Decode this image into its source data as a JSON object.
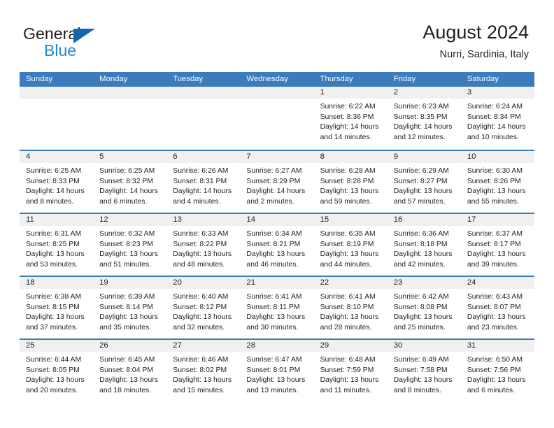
{
  "brand": {
    "name_top": "General",
    "name_bottom": "Blue"
  },
  "header": {
    "title": "August 2024",
    "location": "Nurri, Sardinia, Italy"
  },
  "colors": {
    "header_blue": "#3b7cbe",
    "logo_blue": "#2389cf",
    "triangle_blue": "#1566b0",
    "day_band": "#f0f0f0",
    "text": "#231f20"
  },
  "weekdays": [
    "Sunday",
    "Monday",
    "Tuesday",
    "Wednesday",
    "Thursday",
    "Friday",
    "Saturday"
  ],
  "weeks": [
    [
      {
        "day": "",
        "lines": []
      },
      {
        "day": "",
        "lines": []
      },
      {
        "day": "",
        "lines": []
      },
      {
        "day": "",
        "lines": []
      },
      {
        "day": "1",
        "lines": [
          "Sunrise: 6:22 AM",
          "Sunset: 8:36 PM",
          "Daylight: 14 hours",
          "and 14 minutes."
        ]
      },
      {
        "day": "2",
        "lines": [
          "Sunrise: 6:23 AM",
          "Sunset: 8:35 PM",
          "Daylight: 14 hours",
          "and 12 minutes."
        ]
      },
      {
        "day": "3",
        "lines": [
          "Sunrise: 6:24 AM",
          "Sunset: 8:34 PM",
          "Daylight: 14 hours",
          "and 10 minutes."
        ]
      }
    ],
    [
      {
        "day": "4",
        "lines": [
          "Sunrise: 6:25 AM",
          "Sunset: 8:33 PM",
          "Daylight: 14 hours",
          "and 8 minutes."
        ]
      },
      {
        "day": "5",
        "lines": [
          "Sunrise: 6:25 AM",
          "Sunset: 8:32 PM",
          "Daylight: 14 hours",
          "and 6 minutes."
        ]
      },
      {
        "day": "6",
        "lines": [
          "Sunrise: 6:26 AM",
          "Sunset: 8:31 PM",
          "Daylight: 14 hours",
          "and 4 minutes."
        ]
      },
      {
        "day": "7",
        "lines": [
          "Sunrise: 6:27 AM",
          "Sunset: 8:29 PM",
          "Daylight: 14 hours",
          "and 2 minutes."
        ]
      },
      {
        "day": "8",
        "lines": [
          "Sunrise: 6:28 AM",
          "Sunset: 8:28 PM",
          "Daylight: 13 hours",
          "and 59 minutes."
        ]
      },
      {
        "day": "9",
        "lines": [
          "Sunrise: 6:29 AM",
          "Sunset: 8:27 PM",
          "Daylight: 13 hours",
          "and 57 minutes."
        ]
      },
      {
        "day": "10",
        "lines": [
          "Sunrise: 6:30 AM",
          "Sunset: 8:26 PM",
          "Daylight: 13 hours",
          "and 55 minutes."
        ]
      }
    ],
    [
      {
        "day": "11",
        "lines": [
          "Sunrise: 6:31 AM",
          "Sunset: 8:25 PM",
          "Daylight: 13 hours",
          "and 53 minutes."
        ]
      },
      {
        "day": "12",
        "lines": [
          "Sunrise: 6:32 AM",
          "Sunset: 8:23 PM",
          "Daylight: 13 hours",
          "and 51 minutes."
        ]
      },
      {
        "day": "13",
        "lines": [
          "Sunrise: 6:33 AM",
          "Sunset: 8:22 PM",
          "Daylight: 13 hours",
          "and 48 minutes."
        ]
      },
      {
        "day": "14",
        "lines": [
          "Sunrise: 6:34 AM",
          "Sunset: 8:21 PM",
          "Daylight: 13 hours",
          "and 46 minutes."
        ]
      },
      {
        "day": "15",
        "lines": [
          "Sunrise: 6:35 AM",
          "Sunset: 8:19 PM",
          "Daylight: 13 hours",
          "and 44 minutes."
        ]
      },
      {
        "day": "16",
        "lines": [
          "Sunrise: 6:36 AM",
          "Sunset: 8:18 PM",
          "Daylight: 13 hours",
          "and 42 minutes."
        ]
      },
      {
        "day": "17",
        "lines": [
          "Sunrise: 6:37 AM",
          "Sunset: 8:17 PM",
          "Daylight: 13 hours",
          "and 39 minutes."
        ]
      }
    ],
    [
      {
        "day": "18",
        "lines": [
          "Sunrise: 6:38 AM",
          "Sunset: 8:15 PM",
          "Daylight: 13 hours",
          "and 37 minutes."
        ]
      },
      {
        "day": "19",
        "lines": [
          "Sunrise: 6:39 AM",
          "Sunset: 8:14 PM",
          "Daylight: 13 hours",
          "and 35 minutes."
        ]
      },
      {
        "day": "20",
        "lines": [
          "Sunrise: 6:40 AM",
          "Sunset: 8:12 PM",
          "Daylight: 13 hours",
          "and 32 minutes."
        ]
      },
      {
        "day": "21",
        "lines": [
          "Sunrise: 6:41 AM",
          "Sunset: 8:11 PM",
          "Daylight: 13 hours",
          "and 30 minutes."
        ]
      },
      {
        "day": "22",
        "lines": [
          "Sunrise: 6:41 AM",
          "Sunset: 8:10 PM",
          "Daylight: 13 hours",
          "and 28 minutes."
        ]
      },
      {
        "day": "23",
        "lines": [
          "Sunrise: 6:42 AM",
          "Sunset: 8:08 PM",
          "Daylight: 13 hours",
          "and 25 minutes."
        ]
      },
      {
        "day": "24",
        "lines": [
          "Sunrise: 6:43 AM",
          "Sunset: 8:07 PM",
          "Daylight: 13 hours",
          "and 23 minutes."
        ]
      }
    ],
    [
      {
        "day": "25",
        "lines": [
          "Sunrise: 6:44 AM",
          "Sunset: 8:05 PM",
          "Daylight: 13 hours",
          "and 20 minutes."
        ]
      },
      {
        "day": "26",
        "lines": [
          "Sunrise: 6:45 AM",
          "Sunset: 8:04 PM",
          "Daylight: 13 hours",
          "and 18 minutes."
        ]
      },
      {
        "day": "27",
        "lines": [
          "Sunrise: 6:46 AM",
          "Sunset: 8:02 PM",
          "Daylight: 13 hours",
          "and 15 minutes."
        ]
      },
      {
        "day": "28",
        "lines": [
          "Sunrise: 6:47 AM",
          "Sunset: 8:01 PM",
          "Daylight: 13 hours",
          "and 13 minutes."
        ]
      },
      {
        "day": "29",
        "lines": [
          "Sunrise: 6:48 AM",
          "Sunset: 7:59 PM",
          "Daylight: 13 hours",
          "and 11 minutes."
        ]
      },
      {
        "day": "30",
        "lines": [
          "Sunrise: 6:49 AM",
          "Sunset: 7:58 PM",
          "Daylight: 13 hours",
          "and 8 minutes."
        ]
      },
      {
        "day": "31",
        "lines": [
          "Sunrise: 6:50 AM",
          "Sunset: 7:56 PM",
          "Daylight: 13 hours",
          "and 6 minutes."
        ]
      }
    ]
  ]
}
